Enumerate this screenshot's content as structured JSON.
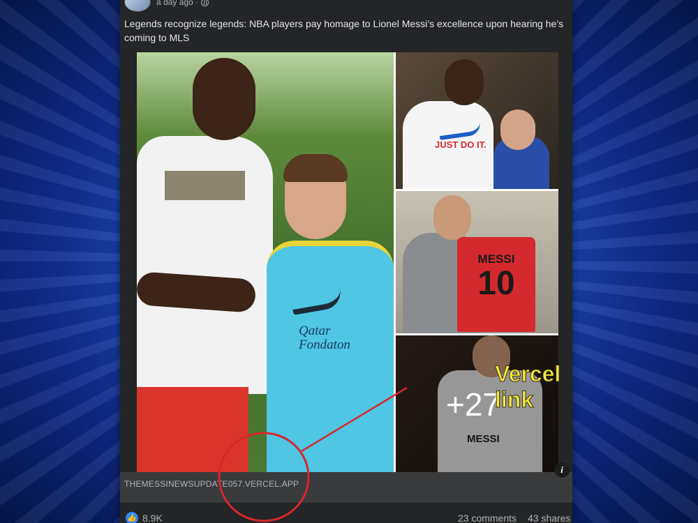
{
  "post": {
    "timestamp": "a day ago ·",
    "privacy_icon": "globe-icon",
    "text": "Legends recognize legends: NBA players pay homage to Lionel Messi’s excellence upon hearing he’s coming to MLS"
  },
  "photos": {
    "main": {
      "vest_text_line1": "Qatar",
      "vest_text_line2": "Fondaton"
    },
    "p1": {
      "shirt_text": "JUST DO IT."
    },
    "p2": {
      "jersey_name": "MESSI",
      "jersey_number": "10"
    },
    "p3": {
      "jersey_name": "MESSI",
      "more_count": "+27"
    }
  },
  "annotation": {
    "label": "Vercel link",
    "color": "#f3e84a",
    "circle_color": "#d9262c"
  },
  "link_preview": {
    "domain": "THEMESSINEWSUPDATE057.VERCEL.APP",
    "info_icon": "info-icon"
  },
  "stats": {
    "likes": "8.9K",
    "comments": "23 comments",
    "shares": "43 shares",
    "like_icon": "thumbs-up-icon"
  }
}
